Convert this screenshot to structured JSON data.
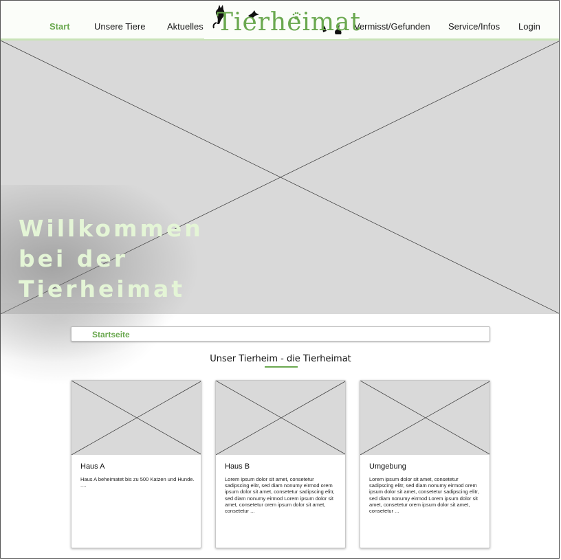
{
  "nav": {
    "items": [
      {
        "label": "Start",
        "active": true
      },
      {
        "label": "Unsere Tiere"
      },
      {
        "label": "Aktuelles"
      },
      {
        "label": "Vermisst/Gefunden"
      },
      {
        "label": "Service/Infos"
      },
      {
        "label": "Login"
      }
    ]
  },
  "logo": {
    "text": "Tierheimat",
    "icons": [
      "cat-silhouette-icon",
      "bird-silhouette-icon",
      "paw-print-icon",
      "rabbit-silhouette-icon"
    ]
  },
  "hero": {
    "title": "Willkommen\nbei der\nTierheimat",
    "image_placeholder": "image-placeholder"
  },
  "breadcrumb": {
    "current": "Startseite"
  },
  "section": {
    "title": "Unser Tierheim - die Tierheimat"
  },
  "cards": [
    {
      "title": "Haus A",
      "text": "Haus A beheimatet bis zu 500 Katzen und Hunde. ...."
    },
    {
      "title": "Haus B",
      "text": "Lorem ipsum dolor sit amet, consetetur sadipscing elitr, sed diam nonumy eirmod orem ipsum dolor sit amet, consetetur sadipscing elitr, sed diam nonumy eirmod Lorem ipsum dolor sit amet, consetetur orem ipsum dolor sit amet, consetetur ..."
    },
    {
      "title": "Umgebung",
      "text": "Lorem ipsum dolor sit amet, consetetur sadipscing elitr, sed diam nonumy eirmod orem ipsum dolor sit amet, consetetur sadipscing elitr, sed diam nonumy eirmod Lorem ipsum dolor sit amet, consetetur orem ipsum dolor sit amet, consetetur ..."
    }
  ],
  "colors": {
    "accent": "#6aa84f",
    "hero_title": "#e4f5d6",
    "placeholder": "#d9d9d9"
  }
}
